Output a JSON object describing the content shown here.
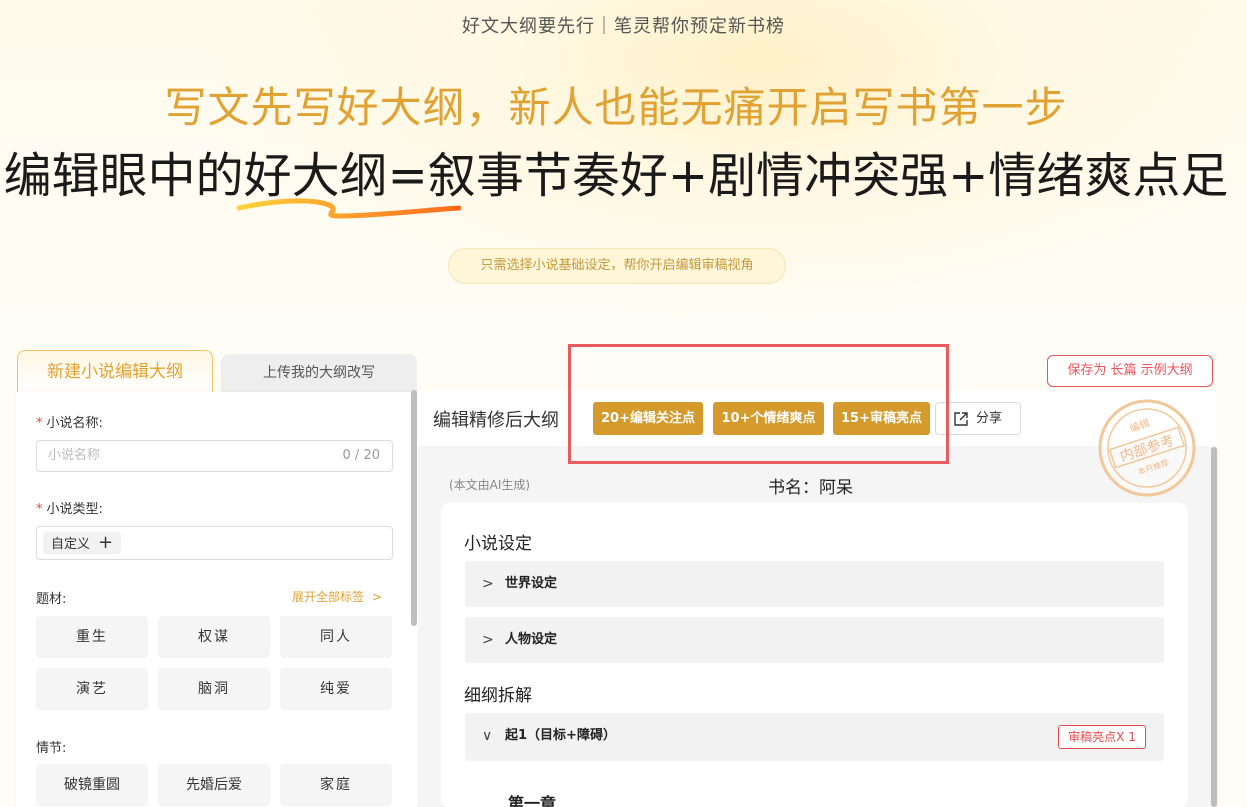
{
  "hero": {
    "tagline": "好文大纲要先行｜笔灵帮你预定新书榜",
    "headline_1": "写文先写好大纲，新人也能无痛开启写书第一步",
    "headline_2": "编辑眼中的好大纲=叙事节奏好+剧情冲突强+情绪爽点足",
    "hint": "只需选择小说基础设定，帮你开启编辑审稿视角"
  },
  "tabs": {
    "new_outline": "新建小说编辑大纲",
    "upload_outline": "上传我的大纲改写"
  },
  "save_example_label": "保存为 长篇 示例大纲",
  "form": {
    "name_label": "小说名称:",
    "name_placeholder": "小说名称",
    "name_counter": "0 / 20",
    "type_label": "小说类型:",
    "type_chip": "自定义",
    "theme_label": "题材:",
    "expand_all": "展开全部标签",
    "theme_tags": [
      "重生",
      "权谋",
      "同人",
      "演艺",
      "脑洞",
      "纯爱"
    ],
    "plot_label": "情节:",
    "plot_tags": [
      "破镜重圆",
      "先婚后爱",
      "家庭"
    ]
  },
  "content": {
    "header_title": "编辑精修后大纲",
    "badges": [
      "20+编辑关注点",
      "10+个情绪爽点",
      "15+审稿亮点"
    ],
    "share_label": "分享",
    "stamp": {
      "top": "编辑",
      "main": "内部参考",
      "bottom": "本月推荐"
    },
    "ai_note": "(本文由AI生成)",
    "book_name": "书名：阿呆",
    "settings_title": "小说设定",
    "world_setting": "世界设定",
    "character_setting": "人物设定",
    "outline_title": "细纲拆解",
    "section_1": "起1（目标+障碍）",
    "review_badge": "审稿亮点X 1",
    "chapter_1": "第一章"
  },
  "colors": {
    "accent_gold": "#e0a233",
    "badge_gold": "#d49a2b",
    "alert_red": "#e54848",
    "highlight_red": "#e85b60"
  }
}
